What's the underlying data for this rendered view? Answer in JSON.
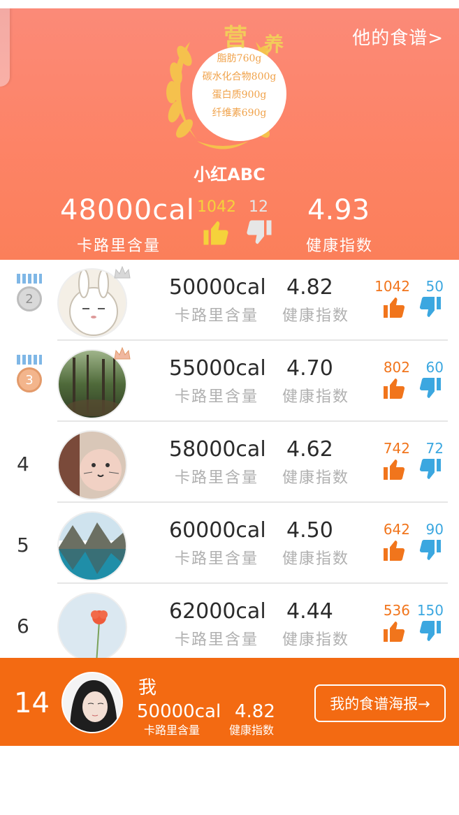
{
  "header": {
    "his_recipes_link": "他的食谱>",
    "badge_title_1": "营",
    "badge_title_2": "养",
    "nutrients": [
      "脂肪760g",
      "碳水化合物800g",
      "蛋白质900g",
      "纤维素690g"
    ],
    "user_name": "小红ABC",
    "calories": "48000cal",
    "calories_label": "卡路里含量",
    "likes": "1042",
    "dislikes": "12",
    "health_score": "4.93",
    "health_label": "健康指数",
    "colors": {
      "likes": "#f5d23b",
      "dislikes": "#e6e6e6"
    },
    "icons": {
      "like": "thumbs-up-icon",
      "dislike": "thumbs-down-icon"
    }
  },
  "ranking": {
    "cal_label": "卡路里含量",
    "score_label": "健康指数",
    "rows": [
      {
        "rank": "2",
        "medal": "silver",
        "calories": "50000cal",
        "score": "4.82",
        "likes": "1042",
        "dislikes": "50",
        "avatar": "rabbit-avatar"
      },
      {
        "rank": "3",
        "medal": "bronze",
        "calories": "55000cal",
        "score": "4.70",
        "likes": "802",
        "dislikes": "60",
        "avatar": "forest-avatar"
      },
      {
        "rank": "4",
        "medal": "",
        "calories": "58000cal",
        "score": "4.62",
        "likes": "742",
        "dislikes": "72",
        "avatar": "cat-face-avatar"
      },
      {
        "rank": "5",
        "medal": "",
        "calories": "60000cal",
        "score": "4.50",
        "likes": "642",
        "dislikes": "90",
        "avatar": "lake-mountain-avatar"
      },
      {
        "rank": "6",
        "medal": "",
        "calories": "62000cal",
        "score": "4.44",
        "likes": "536",
        "dislikes": "150",
        "avatar": "flower-avatar"
      }
    ],
    "colors": {
      "like": "#f1751c",
      "dislike": "#3ba7e0"
    }
  },
  "me": {
    "rank": "14",
    "name": "我",
    "calories": "50000cal",
    "calories_label": "卡路里含量",
    "score": "4.82",
    "score_label": "健康指数",
    "poster_button": "我的食谱海报→",
    "bar_color": "#f36a12"
  }
}
